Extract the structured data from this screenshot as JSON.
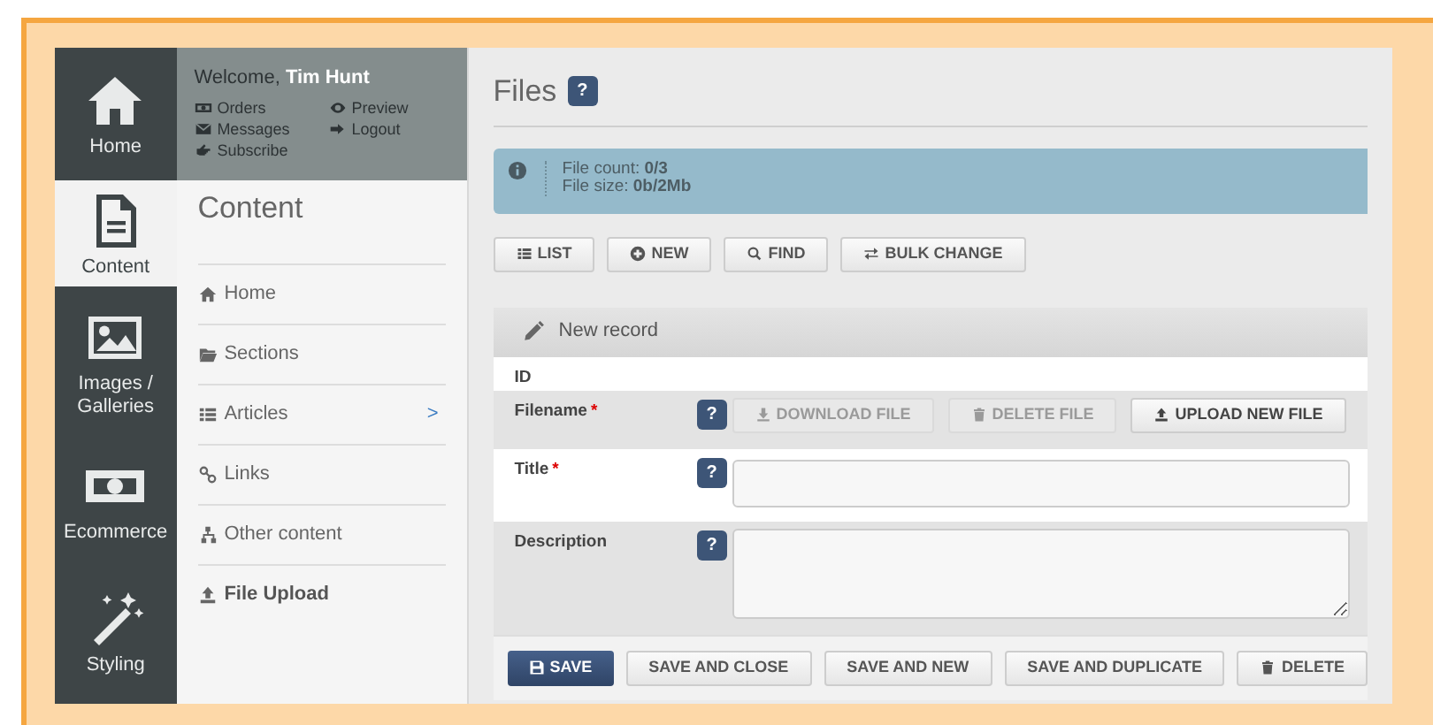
{
  "rail": [
    {
      "label": "Home",
      "selected": false
    },
    {
      "label": "Content",
      "selected": true
    },
    {
      "label": "Images / Galleries",
      "selected": false
    },
    {
      "label": "Ecommerce",
      "selected": false
    },
    {
      "label": "Styling",
      "selected": false
    }
  ],
  "user": {
    "greeting": "Welcome,",
    "name": "Tim Hunt",
    "links": [
      "Orders",
      "Preview",
      "Messages",
      "Logout",
      "Subscribe"
    ]
  },
  "section": {
    "title": "Content",
    "items": [
      {
        "label": "Home",
        "selected": false
      },
      {
        "label": "Sections",
        "selected": false
      },
      {
        "label": "Articles",
        "selected": false,
        "submenu_mark": ">"
      },
      {
        "label": "Links",
        "selected": false
      },
      {
        "label": "Other content",
        "selected": false
      },
      {
        "label": "File Upload",
        "selected": true
      }
    ]
  },
  "page": {
    "title": "Files",
    "help": "?",
    "info": [
      {
        "label": "File count: ",
        "value": "0/3"
      },
      {
        "label": "File size: ",
        "value": "0b/2Mb"
      }
    ],
    "toolbar": [
      "LIST",
      "NEW",
      "FIND",
      "BULK CHANGE"
    ],
    "panel_title": "New record",
    "fields": [
      {
        "label": "ID",
        "kind": "plain"
      },
      {
        "label": "Filename",
        "kind": "file",
        "required_mark": "*",
        "help": "?",
        "buttons": [
          {
            "label": "DOWNLOAD FILE",
            "disabled": true
          },
          {
            "label": "DELETE FILE",
            "disabled": true
          },
          {
            "label": "UPLOAD NEW FILE",
            "disabled": false
          }
        ]
      },
      {
        "label": "Title",
        "kind": "text",
        "required_mark": "*",
        "help": "?"
      },
      {
        "label": "Description",
        "kind": "textarea",
        "help": "?"
      }
    ],
    "actions": [
      {
        "label": "SAVE",
        "kind": "primary"
      },
      {
        "label": "SAVE AND CLOSE",
        "kind": "default"
      },
      {
        "label": "SAVE AND NEW",
        "kind": "default"
      },
      {
        "label": "SAVE AND DUPLICATE",
        "kind": "default"
      },
      {
        "label": "DELETE",
        "kind": "delete"
      }
    ]
  }
}
